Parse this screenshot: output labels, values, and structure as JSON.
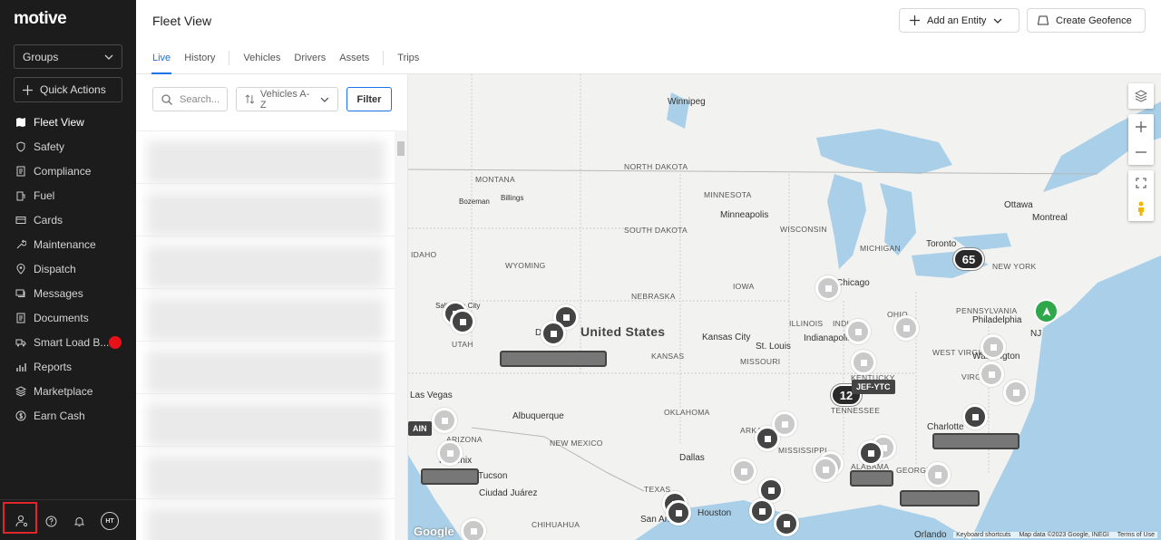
{
  "brand": {
    "logo_text": "motive"
  },
  "sidebar": {
    "groups_label": "Groups",
    "quick_actions_label": "Quick Actions",
    "items": [
      {
        "label": "Fleet View",
        "icon": "map-icon",
        "active": true
      },
      {
        "label": "Safety",
        "icon": "shield-icon"
      },
      {
        "label": "Compliance",
        "icon": "document-icon"
      },
      {
        "label": "Fuel",
        "icon": "fuel-icon"
      },
      {
        "label": "Cards",
        "icon": "card-icon"
      },
      {
        "label": "Maintenance",
        "icon": "wrench-icon"
      },
      {
        "label": "Dispatch",
        "icon": "pin-icon"
      },
      {
        "label": "Messages",
        "icon": "message-icon"
      },
      {
        "label": "Documents",
        "icon": "document-icon"
      },
      {
        "label": "Smart Load B...",
        "icon": "truck-icon",
        "badge_color": "#e8111a"
      },
      {
        "label": "Reports",
        "icon": "chart-icon"
      },
      {
        "label": "Marketplace",
        "icon": "layers-icon"
      },
      {
        "label": "Earn Cash",
        "icon": "dollar-icon"
      }
    ],
    "bottom": {
      "avatar_initials": "HT"
    }
  },
  "header": {
    "title": "Fleet View",
    "add_entity_label": "Add an Entity",
    "create_geofence_label": "Create Geofence",
    "tabs": [
      {
        "label": "Live",
        "active": true
      },
      {
        "label": "History"
      },
      {
        "label": "Vehicles"
      },
      {
        "label": "Drivers"
      },
      {
        "label": "Assets"
      },
      {
        "label": "Trips"
      }
    ]
  },
  "listpanel": {
    "search_placeholder": "Search...",
    "sort_label": "Vehicles A-Z",
    "filter_label": "Filter"
  },
  "map": {
    "country_label": "United States",
    "state_labels": [
      "MONTANA",
      "NORTH DAKOTA",
      "SOUTH DAKOTA",
      "MINNESOTA",
      "WISCONSIN",
      "MICHIGAN",
      "IDAHO",
      "WYOMING",
      "NEBRASKA",
      "IOWA",
      "ILLINOIS",
      "INDIANA",
      "OHIO",
      "PENNSYLVANIA",
      "NEW YORK",
      "UTAH",
      "KANSAS",
      "MISSOURI",
      "KENTUCKY",
      "WEST VIRGINIA",
      "VIRGINIA",
      "TENNESSEE",
      "ARIZONA",
      "NEW MEXICO",
      "OKLAHOMA",
      "ARKANSAS",
      "MISSISSIPPI",
      "ALABAMA",
      "GEORGIA",
      "TEXAS",
      "CHIHUAHUA"
    ],
    "city_labels": [
      "Winnipeg",
      "Bozeman",
      "Billings",
      "Minneapolis",
      "Ottawa",
      "Montreal",
      "Toronto",
      "Philadelphia",
      "Washington",
      "Indianapolis",
      "Kansas City",
      "St. Louis",
      "Charlotte",
      "Albuquerque",
      "Phoenix",
      "Tucson",
      "Ciudad Juárez",
      "Dallas",
      "Houston",
      "San Antonio",
      "Orlando",
      "Salt Lake City",
      "Denver",
      "Las Vegas",
      "NJ",
      "Chicago"
    ],
    "cluster_a": "65",
    "cluster_b": "12",
    "vehicle_tag": "JEF-YTC",
    "vehicle_tag_partial": "AIN",
    "attribution": {
      "shortcuts": "Keyboard shortcuts",
      "data": "Map data ©2023 Google, INEGI",
      "terms": "Terms of Use"
    },
    "google_logo": "Google"
  }
}
